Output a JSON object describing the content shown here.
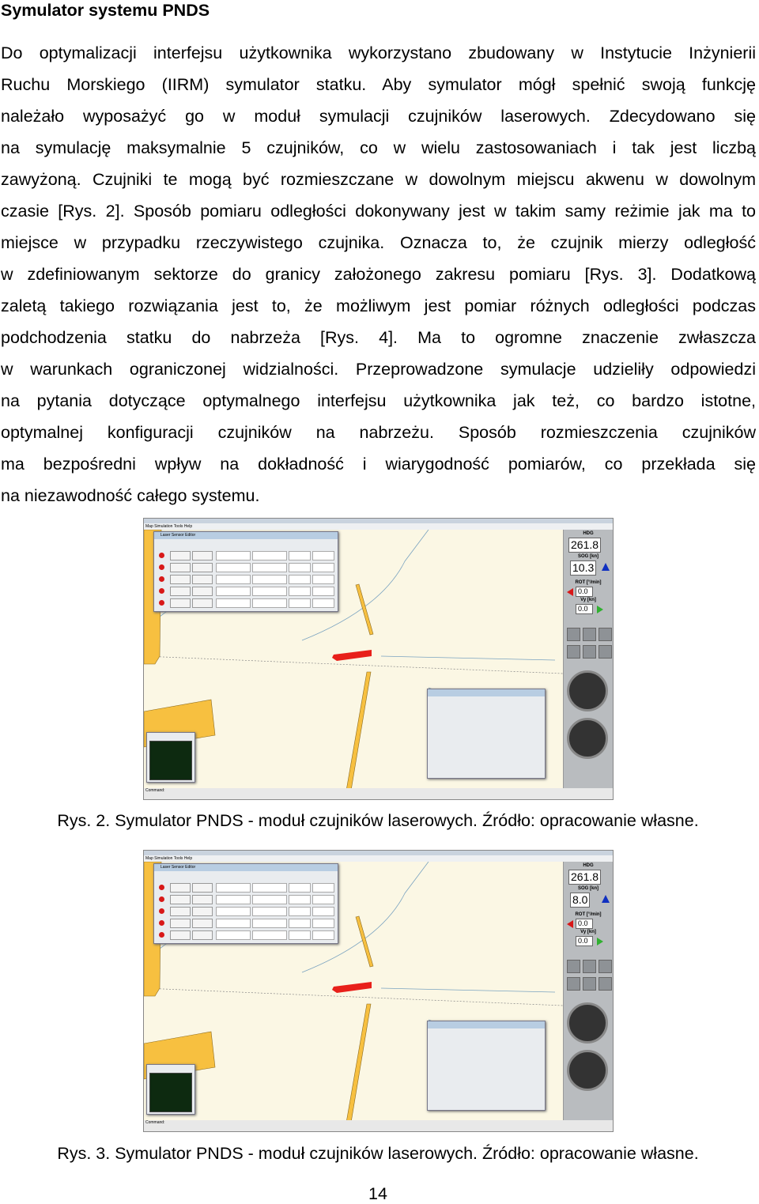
{
  "title": "Symulator systemu PNDS",
  "paragraph_lines": [
    "Do optymalizacji interfejsu użytkownika wykorzystano zbudowany w Instytucie Inżynierii",
    "Ruchu Morskiego (IIRM) symulator statku. Aby symulator mógł spełnić swoją funkcję",
    "należało wyposażyć go w moduł symulacji czujników laserowych. Zdecydowano się",
    "na symulację maksymalnie 5 czujników, co w wielu zastosowaniach i tak jest liczbą",
    "zawyżoną. Czujniki te mogą być rozmieszczane w dowolnym miejscu akwenu w dowolnym",
    "czasie [Rys. 2]. Sposób pomiaru odległości dokonywany jest w takim samy reżimie jak ma to",
    "miejsce w przypadku rzeczywistego czujnika. Oznacza to, że czujnik mierzy odległość",
    "w zdefiniowanym sektorze do granicy założonego zakresu pomiaru [Rys. 3]. Dodatkową",
    "zaletą takiego rozwiązania jest to, że możliwym jest pomiar różnych odległości podczas",
    "podchodzenia statku do nabrzeża [Rys. 4]. Ma to ogromne znaczenie zwłaszcza",
    "w warunkach ograniczonej widzialności. Przeprowadzone symulacje udzieliły odpowiedzi",
    "na pytania dotyczące optymalnego interfejsu użytkownika jak też, co bardzo istotne,",
    "optymalnej konfiguracji czujników na nabrzeżu. Sposób rozmieszczenia czujników",
    "ma bezpośredni wpływ na dokładność i wiarygodność pomiarów, co przekłada się",
    "na niezawodność całego systemu."
  ],
  "figures": [
    {
      "caption": "Rys. 2. Symulator PNDS - moduł czujników laserowych. Źródło: opracowanie własne.",
      "menu": "Map  Simulation  Tools  Help",
      "editor_title": "Laser Sensor Editor",
      "hdg_label": "HDG",
      "hdg": "261.8",
      "sog_label": "SOG [kn]",
      "sog": "10.3",
      "rot_label": "ROT [°/min]",
      "rot": "0.0",
      "vy_label": "Vy [kn]",
      "vy": "0.0",
      "status": "Command:"
    },
    {
      "caption": "Rys. 3. Symulator PNDS - moduł czujników laserowych. Źródło: opracowanie własne.",
      "menu": "Map  Simulation  Tools  Help",
      "editor_title": "Laser Sensor Editor",
      "hdg_label": "HDG",
      "hdg": "261.8",
      "sog_label": "SOG [kn]",
      "sog": "8.0",
      "rot_label": "ROT [°/min]",
      "rot": "0.0",
      "vy_label": "Vy [kn]",
      "vy": "0.0",
      "status": "Command:"
    }
  ],
  "colors": {
    "map_bg": "#fbf7e4",
    "quay": "#f7c040",
    "ship": "#e8201a",
    "sensor": "#d81818"
  },
  "page_number": "14"
}
